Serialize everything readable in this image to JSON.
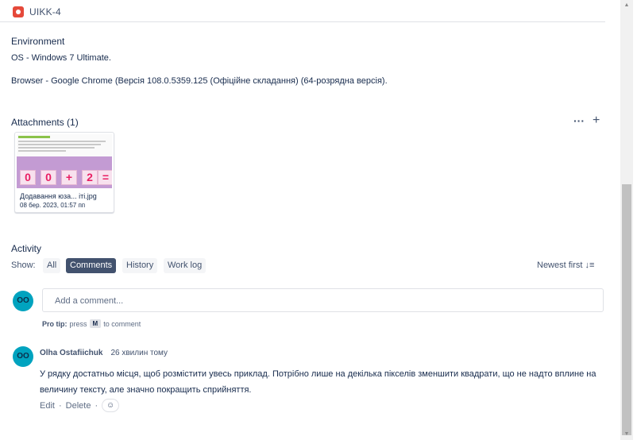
{
  "issue": {
    "key": "UIKK-4",
    "icon": "bug-icon",
    "icon_color": "#e5493a"
  },
  "environment": {
    "label": "Environment",
    "os_line": "OS - Windows 7 Ultimate.",
    "browser_line": "Browser - Google Chrome (Версія 108.0.5359.125 (Офіційне складання) (64-розрядна версія)."
  },
  "attachments": {
    "title": "Attachments (1)",
    "more_icon": "more-icon",
    "add_icon": "plus-icon",
    "items": [
      {
        "name": "Додавання юза... іті.jpg",
        "date": "08 бер. 2023, 01:57 пп",
        "thumb_text": "0 + 2 ="
      }
    ]
  },
  "activity": {
    "title": "Activity",
    "show_label": "Show:",
    "tabs": [
      "All",
      "Comments",
      "History",
      "Work log"
    ],
    "active_tab": "Comments",
    "sort_label": "Newest first",
    "sort_icon": "sort-icon"
  },
  "composer": {
    "avatar": "OO",
    "placeholder": "Add a comment...",
    "protip_label": "Pro tip:",
    "protip_press": "press",
    "protip_key": "M",
    "protip_suffix": "to comment"
  },
  "comments": [
    {
      "avatar": "OO",
      "author": "Olha Ostafiichuk",
      "time": "26 хвилин тому",
      "text": "У рядку достатньо місця, щоб розмістити увесь приклад. Потрібно лише на декілька пікселів зменшити квадрати, що не надто вплине на величину тексту, але значно покращить сприйняття.",
      "edit_label": "Edit",
      "delete_label": "Delete",
      "react_icon": "emoji-icon"
    }
  ],
  "colors": {
    "accent_tab": "#42526e",
    "avatar_bg": "#00a3bf",
    "bug": "#e5493a"
  }
}
